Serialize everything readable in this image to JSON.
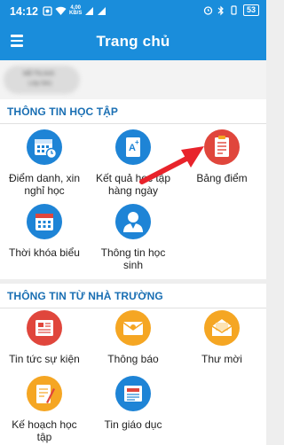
{
  "status_bar": {
    "time": "14:12",
    "speed_value": "4,00",
    "speed_unit": "KB/S",
    "battery": "53"
  },
  "appbar": {
    "title": "Trang chủ"
  },
  "user": {
    "name": "Mẫ Thị Anh",
    "class": "Lớp 5A1"
  },
  "section1": {
    "title": "THÔNG TIN HỌC TẬP",
    "items": [
      {
        "label": "Điểm danh, xin nghỉ học",
        "icon": "calendar-clock-icon"
      },
      {
        "label": "Kết quả học tập hàng ngày",
        "icon": "grade-paper-icon"
      },
      {
        "label": "Bảng điểm",
        "icon": "report-card-icon"
      },
      {
        "label": "Thời khóa biểu",
        "icon": "calendar-icon"
      },
      {
        "label": "Thông tin học sinh",
        "icon": "student-icon"
      }
    ]
  },
  "section2": {
    "title": "THÔNG TIN TỪ NHÀ TRƯỜNG",
    "items": [
      {
        "label": "Tin tức sự kiện",
        "icon": "newspaper-icon"
      },
      {
        "label": "Thông báo",
        "icon": "envelope-icon"
      },
      {
        "label": "Thư mời",
        "icon": "open-envelope-icon"
      },
      {
        "label": "Kế hoạch học tập",
        "icon": "notebook-pencil-icon"
      },
      {
        "label": "Tin giáo dục",
        "icon": "education-news-icon"
      }
    ]
  },
  "colors": {
    "primary": "#1a8ddb",
    "section_title": "#1a6fb3",
    "icon_blue": "#1e84d6",
    "icon_orange": "#f5a623",
    "icon_red": "#e0463c",
    "arrow": "#e8232b"
  }
}
